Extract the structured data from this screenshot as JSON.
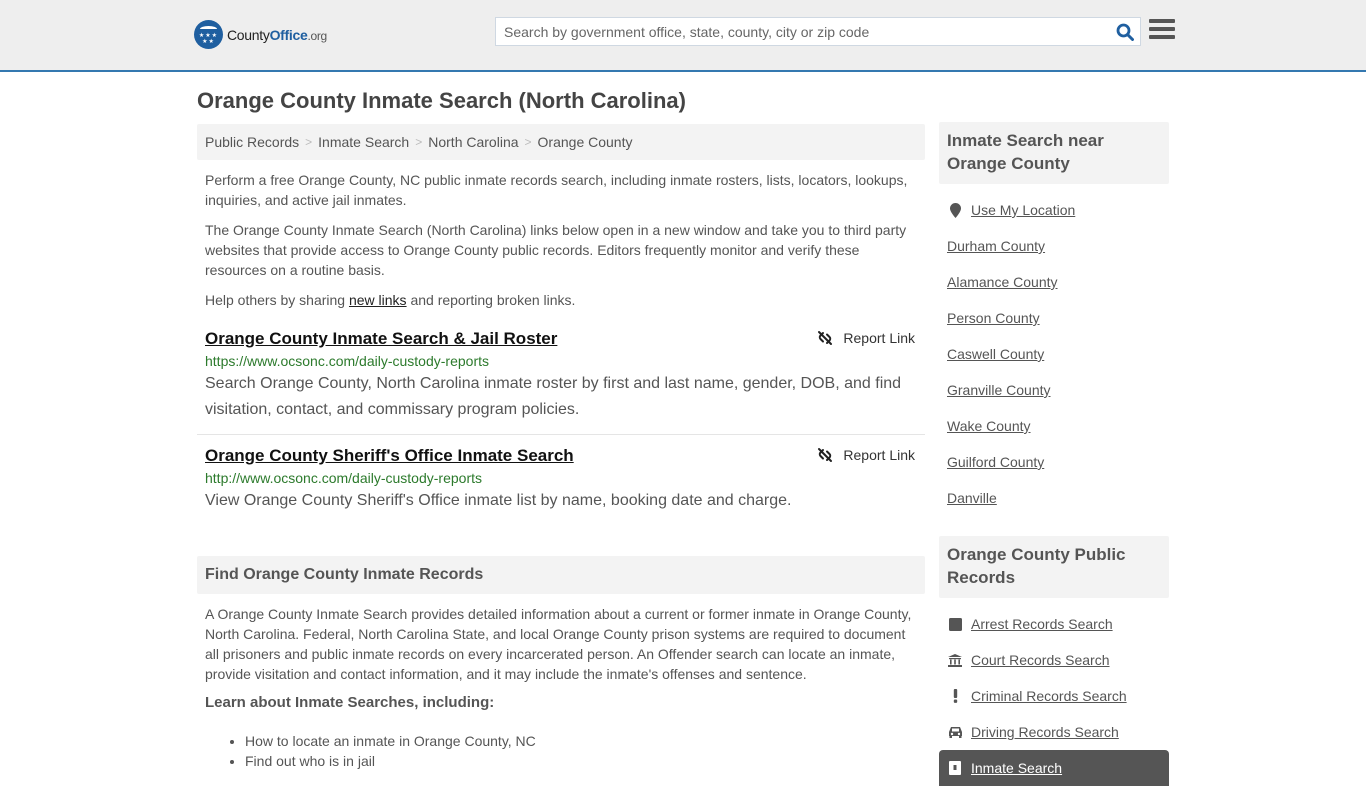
{
  "header": {
    "logo": {
      "prefix": "County",
      "brand": "Office",
      "tld": ".org"
    },
    "search": {
      "placeholder": "Search by government office, state, county, city or zip code",
      "value": ""
    },
    "search_icon": "search-icon",
    "menu_icon": "hamburger-menu-icon"
  },
  "page": {
    "title": "Orange County Inmate Search (North Carolina)"
  },
  "breadcrumb": [
    {
      "label": "Public Records"
    },
    {
      "label": "Inmate Search"
    },
    {
      "label": "North Carolina"
    },
    {
      "label": "Orange County"
    }
  ],
  "intro": {
    "p1": "Perform a free Orange County, NC public inmate records search, including inmate rosters, lists, locators, lookups, inquiries, and active jail inmates.",
    "p2": "The Orange County Inmate Search (North Carolina) links below open in a new window and take you to third party websites that provide access to Orange County public records. Editors frequently monitor and verify these resources on a routine basis.",
    "p3_before": "Help others by sharing ",
    "p3_link": "new links",
    "p3_after": " and reporting broken links."
  },
  "results": [
    {
      "title": "Orange County Inmate Search & Jail Roster",
      "url": "https://www.ocsonc.com/daily-custody-reports",
      "description": "Search Orange County, North Carolina inmate roster by first and last name, gender, DOB, and find visitation, contact, and commissary program policies.",
      "report_label": "Report Link"
    },
    {
      "title": "Orange County Sheriff's Office Inmate Search",
      "url": "http://www.ocsonc.com/daily-custody-reports",
      "description": "View Orange County Sheriff's Office inmate list by name, booking date and charge.",
      "report_label": "Report Link"
    }
  ],
  "find_section": {
    "heading": "Find Orange County Inmate Records",
    "body": "A Orange County Inmate Search provides detailed information about a current or former inmate in Orange County, North Carolina. Federal, North Carolina State, and local Orange County prison systems are required to document all prisoners and public inmate records on every incarcerated person. An Offender search can locate an inmate, provide visitation and contact information, and it may include the inmate's offenses and sentence.",
    "subheading": "Learn about Inmate Searches, including:",
    "bullets": [
      "How to locate an inmate in Orange County, NC",
      "Find out who is in jail"
    ]
  },
  "sidebar": {
    "nearby": {
      "heading": "Inmate Search near Orange County",
      "location_label": "Use My Location",
      "items": [
        "Durham County",
        "Alamance County",
        "Person County",
        "Caswell County",
        "Granville County",
        "Wake County",
        "Guilford County",
        "Danville"
      ]
    },
    "public_records": {
      "heading": "Orange County Public Records",
      "items": [
        {
          "label": "Arrest Records Search",
          "icon": "arrest-book-icon"
        },
        {
          "label": "Court Records Search",
          "icon": "courthouse-icon"
        },
        {
          "label": "Criminal Records Search",
          "icon": "exclamation-icon"
        },
        {
          "label": "Driving Records Search",
          "icon": "car-icon"
        },
        {
          "label": "Inmate Search",
          "icon": "jail-door-icon",
          "active": true
        }
      ]
    }
  },
  "colors": {
    "brand_blue": "#1f5fa0",
    "header_border": "#3478b0",
    "url_green": "#2c7a2c",
    "active_item_bg": "#555555"
  }
}
